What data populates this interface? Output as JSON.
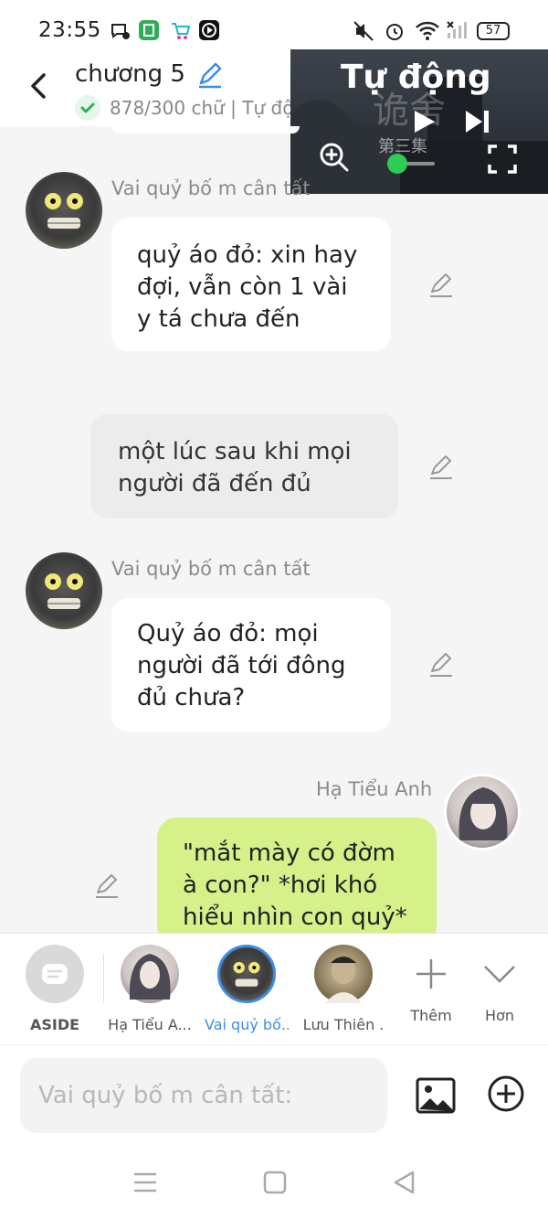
{
  "status_bar": {
    "time": "23:55",
    "battery": "57",
    "left_icons": [
      "chat-bubble-icon",
      "app-green-icon",
      "shopping-cart-icon",
      "play-box-icon"
    ],
    "right_icons": [
      "mute-vibrate-icon",
      "alarm-icon",
      "wifi-icon",
      "signal-icon"
    ]
  },
  "header": {
    "title": "chương 5",
    "word_count": "878/300 chữ | Tự độ"
  },
  "video": {
    "mode_label": "Tự động",
    "watermark_title": "诡舍",
    "episode_label": "第三集",
    "progress": 0.15
  },
  "messages": [
    {
      "type": "character",
      "sender": "Vai quỷ bố m cân tất",
      "lines": [
        "quỷ áo đỏ: xin hay",
        "đợi, vẫn còn 1 vài",
        "y tá chưa đến"
      ]
    },
    {
      "type": "narration",
      "lines": [
        "một lúc sau khi mọi",
        "người đã đến đủ"
      ]
    },
    {
      "type": "character",
      "sender": "Vai quỷ bố m cân tất",
      "lines": [
        "Quỷ áo đỏ: mọi",
        "người đã tới đông",
        "đủ chưa?"
      ]
    },
    {
      "type": "self",
      "sender": "Hạ Tiểu Anh",
      "lines": [
        "\"mắt mày có đờm",
        "à con?\" *hơi khó",
        "hiểu nhìn con quỷ*"
      ]
    }
  ],
  "character_bar": {
    "aside_label": "ASIDE",
    "characters": [
      {
        "label": "Hạ Tiểu A..."
      },
      {
        "label": "Vai quỷ bố..."
      },
      {
        "label": "Lưu Thiên ."
      }
    ],
    "more_label": "Thêm",
    "expand_label": "Hơn"
  },
  "input": {
    "placeholder": "Vai quỷ bố m cân tất:"
  },
  "colors": {
    "accent_blue": "#3a8ee6",
    "self_bubble": "#d6f08a",
    "narration_bubble": "#ececec",
    "progress_green": "#2ecc54"
  }
}
